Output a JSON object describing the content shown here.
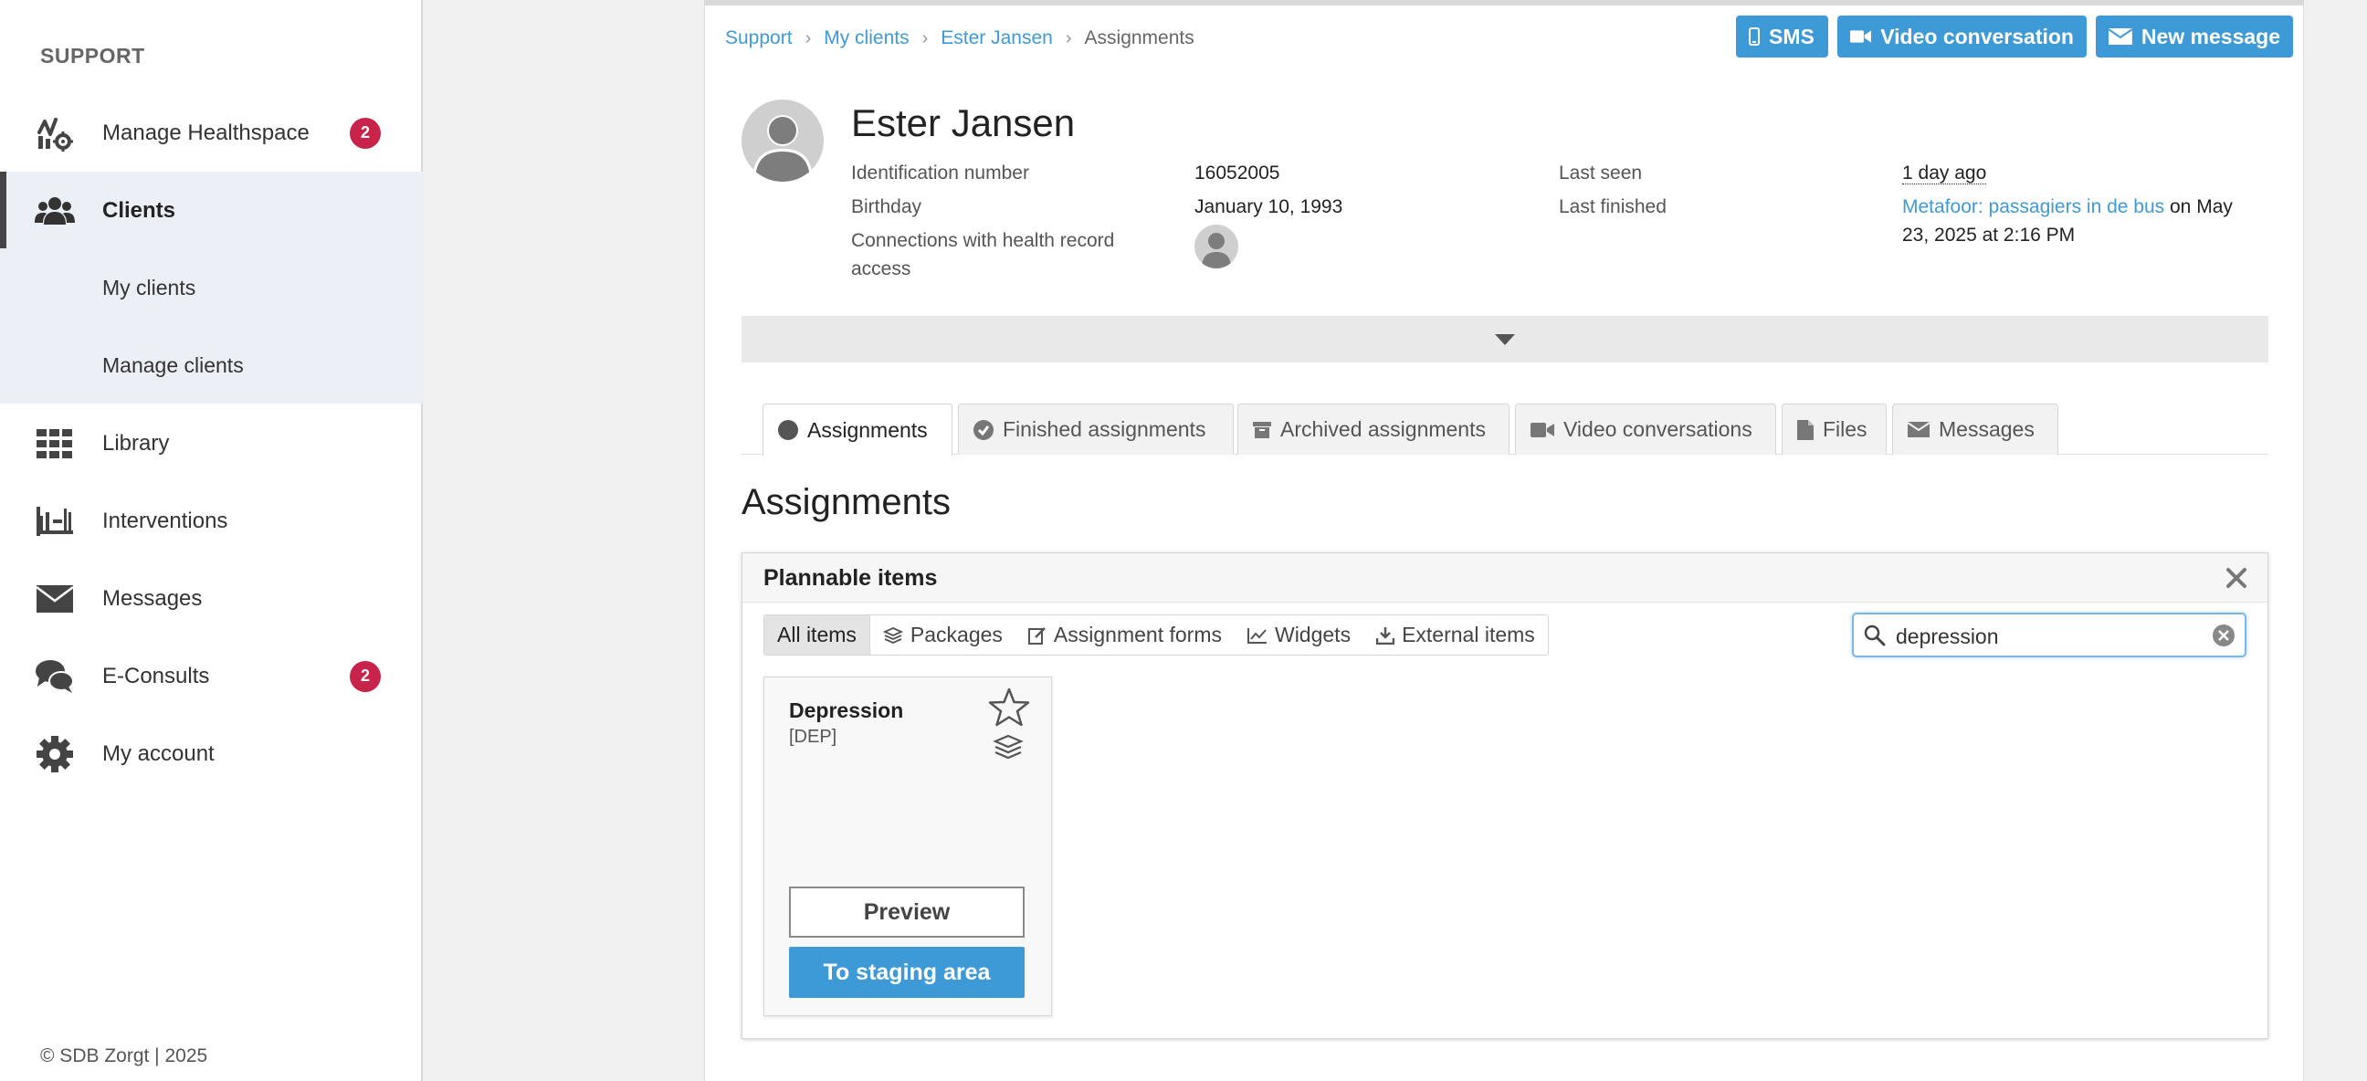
{
  "sidebar": {
    "title": "SUPPORT",
    "items": [
      {
        "label": "Manage Healthspace",
        "icon": "healthspace-settings-icon",
        "badge": "2"
      },
      {
        "label": "Clients",
        "icon": "users-icon",
        "active": true
      },
      {
        "label": "Library",
        "icon": "grid-icon"
      },
      {
        "label": "Interventions",
        "icon": "interventions-icon"
      },
      {
        "label": "Messages",
        "icon": "envelope-icon"
      },
      {
        "label": "E-Consults",
        "icon": "chat-bubbles-icon",
        "badge": "2"
      },
      {
        "label": "My account",
        "icon": "gear-icon"
      }
    ],
    "sub_items": [
      {
        "label": "My clients"
      },
      {
        "label": "Manage clients"
      }
    ],
    "footer": "© SDB Zorgt | 2025"
  },
  "breadcrumb": {
    "items": [
      "Support",
      "My clients",
      "Ester Jansen"
    ],
    "current": "Assignments"
  },
  "actions": {
    "sms": "SMS",
    "video": "Video conversation",
    "new_message": "New message"
  },
  "client": {
    "name": "Ester Jansen",
    "id_label": "Identification number",
    "id_value": "16052005",
    "birthday_label": "Birthday",
    "birthday_value": "January 10, 1993",
    "connections_label": "Connections with health record access",
    "last_seen_label": "Last seen",
    "last_seen_value": "1 day ago",
    "last_finished_label": "Last finished",
    "last_finished_link": "Metafoor: passagiers in de bus",
    "last_finished_suffix": " on May 23, 2025 at 2:16 PM"
  },
  "tabs": [
    {
      "label": "Assignments",
      "icon": "circle-icon",
      "active": true
    },
    {
      "label": "Finished assignments",
      "icon": "check-circle-icon"
    },
    {
      "label": "Archived assignments",
      "icon": "archive-icon"
    },
    {
      "label": "Video conversations",
      "icon": "video-camera-icon"
    },
    {
      "label": "Files",
      "icon": "file-icon"
    },
    {
      "label": "Messages",
      "icon": "envelope-icon"
    }
  ],
  "section": {
    "title": "Assignments"
  },
  "plannable": {
    "title": "Plannable items",
    "filters": [
      {
        "label": "All items",
        "active": true
      },
      {
        "label": "Packages",
        "icon": "layers-icon"
      },
      {
        "label": "Assignment forms",
        "icon": "edit-form-icon"
      },
      {
        "label": "Widgets",
        "icon": "line-chart-icon"
      },
      {
        "label": "External items",
        "icon": "download-tray-icon"
      }
    ],
    "search": {
      "value": "depression"
    },
    "items": [
      {
        "title": "Depression",
        "code": "[DEP]",
        "preview": "Preview",
        "staging": "To staging area"
      }
    ]
  },
  "colors": {
    "accent": "#3e9ad6",
    "badge": "#c8234a",
    "active_bg": "#eaf0f5"
  }
}
